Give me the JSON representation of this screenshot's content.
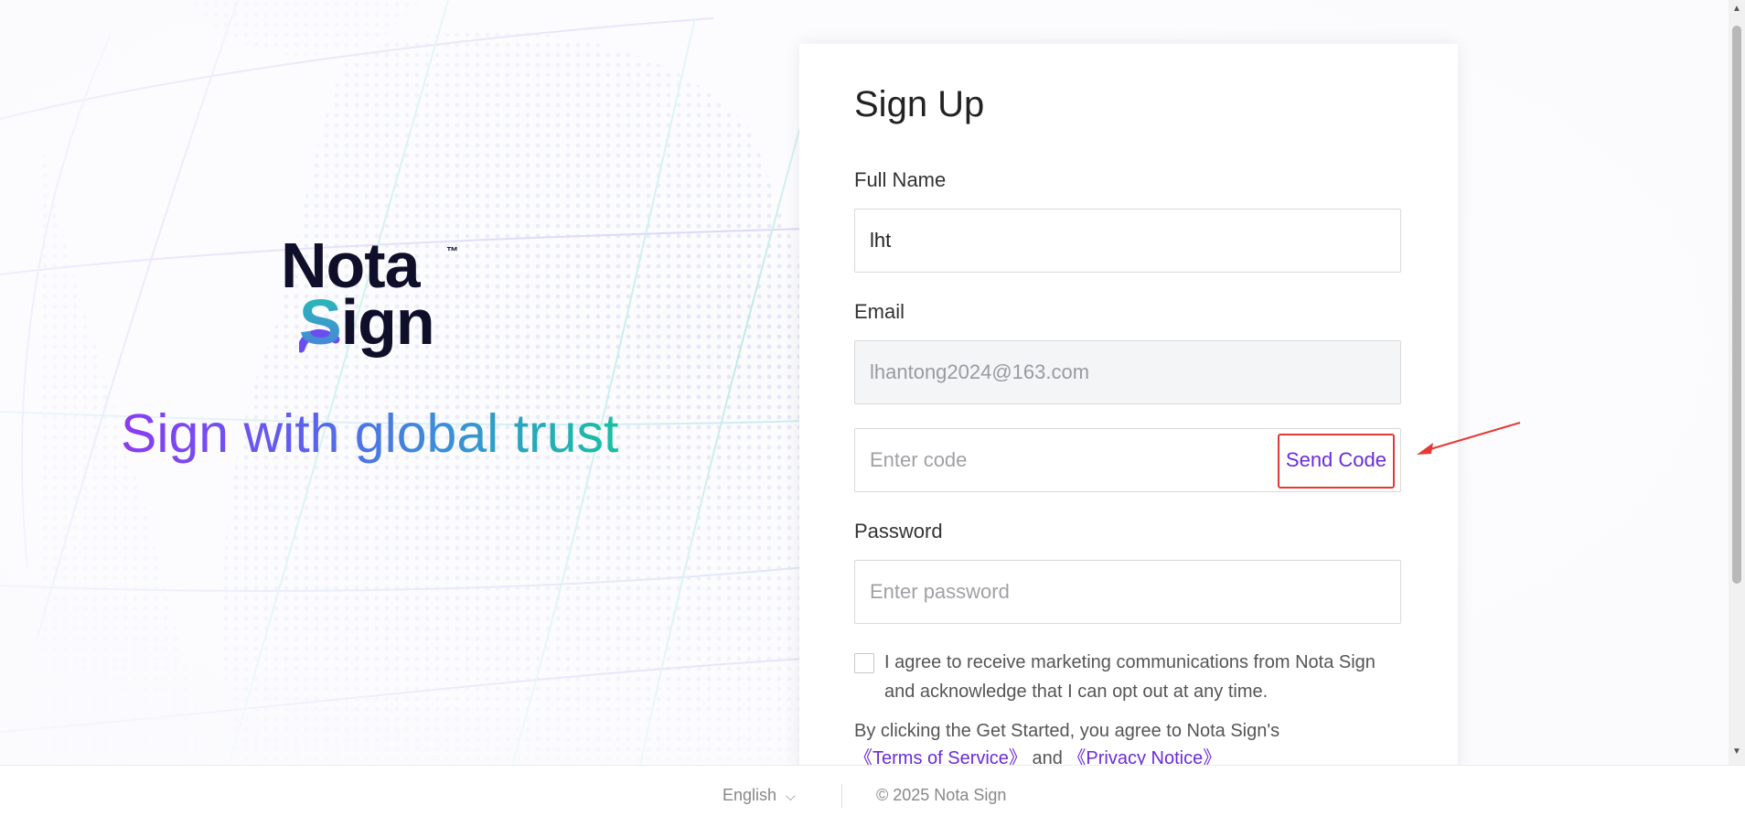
{
  "brand": {
    "logo_line1": "Nota",
    "logo_tm": "™",
    "logo_line2_s": "S",
    "logo_line2_rest": "ign",
    "tagline": "Sign with global trust"
  },
  "form": {
    "title": "Sign Up",
    "full_name_label": "Full Name",
    "full_name_value": "lht",
    "email_label": "Email",
    "email_value": "lhantong2024@163.com",
    "code_placeholder": "Enter code",
    "send_code_label": "Send Code",
    "password_label": "Password",
    "password_placeholder": "Enter password",
    "marketing_consent": "I agree to receive marketing communications from Nota Sign and acknowledge that I can opt out at any time.",
    "terms_prefix": "By clicking the Get Started, you agree to Nota Sign's",
    "terms_link": "《Terms of Service》",
    "terms_and": "and",
    "privacy_link": "《Privacy Notice》"
  },
  "footer": {
    "language": "English",
    "copyright": "© 2025 Nota Sign"
  },
  "colors": {
    "accent": "#6a2cd8",
    "highlight_box": "#e53935",
    "logo_dark": "#0f0f2a"
  },
  "icons": {
    "language_dropdown": "chevron-down-icon",
    "annotation": "arrow-icon"
  }
}
